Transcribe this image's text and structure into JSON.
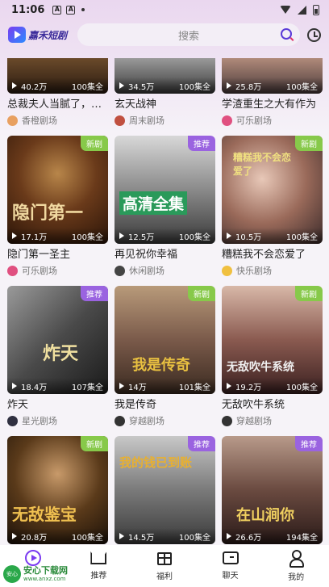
{
  "status_bar": {
    "time": "11:06",
    "icons": [
      "a-notification-icon",
      "a-notification-icon",
      "dot-icon",
      "wifi-icon",
      "signal-icon",
      "battery-icon"
    ]
  },
  "header": {
    "logo_text": "嘉禾短剧",
    "search_placeholder": "搜索"
  },
  "rows": [
    [
      {
        "views": "40.2万",
        "episodes": "100集全",
        "title": "总裁夫人当腻了，今...",
        "source": "香橙剧场",
        "badge": "",
        "poster_text": "",
        "bg": "#3a2a1a",
        "avatar": "#e8a060"
      },
      {
        "views": "34.5万",
        "episodes": "100集全",
        "title": "玄天战神",
        "source": "周末剧场",
        "badge": "",
        "poster_text": "",
        "bg": "#4a4a4a",
        "avatar": "#c05040"
      },
      {
        "views": "25.8万",
        "episodes": "100集全",
        "title": "学渣重生之大有作为",
        "source": "可乐剧场",
        "badge": "",
        "poster_text": "",
        "bg": "#6a5a5a",
        "avatar": "#e05080"
      }
    ],
    [
      {
        "views": "17.1万",
        "episodes": "100集全",
        "title": "隐门第一圣主",
        "source": "可乐剧场",
        "badge": "新剧",
        "badge_type": "new",
        "poster_text": "隐门第一",
        "bg": "#5a2a1a",
        "avatar": "#e05080"
      },
      {
        "views": "12.5万",
        "episodes": "100集全",
        "title": "再见祝你幸福",
        "source": "休闲剧场",
        "badge": "推荐",
        "badge_type": "rec",
        "poster_text": "高清全集",
        "bg": "#8a8a8a",
        "avatar": "#444444"
      },
      {
        "views": "10.5万",
        "episodes": "100集全",
        "title": "糟糕我不会恋爱了",
        "source": "快乐剧场",
        "badge": "新剧",
        "badge_type": "new",
        "poster_text": "糟糕我不会恋爱了",
        "bg": "#7a5a50",
        "avatar": "#f0c040"
      }
    ],
    [
      {
        "views": "18.4万",
        "episodes": "107集全",
        "title": "炸天",
        "source": "星光剧场",
        "badge": "推荐",
        "badge_type": "rec",
        "poster_text": "炸天",
        "bg": "#3a3a3a",
        "avatar": "#303040"
      },
      {
        "views": "14万",
        "episodes": "101集全",
        "title": "我是传奇",
        "source": "穿越剧场",
        "badge": "新剧",
        "badge_type": "new",
        "poster_text": "我是传奇",
        "bg": "#6a4a3a",
        "avatar": "#333333"
      },
      {
        "views": "19.2万",
        "episodes": "100集全",
        "title": "无敌吹牛系统",
        "source": "穿越剧场",
        "badge": "新剧",
        "badge_type": "new",
        "poster_text": "无敌吹牛系统",
        "bg": "#5a3a3a",
        "avatar": "#333333"
      }
    ],
    [
      {
        "views": "20.8万",
        "episodes": "100集全",
        "title": "",
        "source": "",
        "badge": "新剧",
        "badge_type": "new",
        "poster_text": "无敌鉴宝",
        "bg": "#3a2a1a",
        "avatar": ""
      },
      {
        "views": "14.5万",
        "episodes": "100集全",
        "title": "",
        "source": "",
        "badge": "推荐",
        "badge_type": "rec",
        "poster_text": "我的钱已到账",
        "bg": "#6a6a6a",
        "avatar": ""
      },
      {
        "views": "26.6万",
        "episodes": "194集全",
        "title": "",
        "source": "",
        "badge": "推荐",
        "badge_type": "rec",
        "poster_text": "在山涧你",
        "bg": "#5a4a4a",
        "avatar": ""
      }
    ]
  ],
  "bottom_nav": [
    {
      "label": "",
      "icon": "play-icon"
    },
    {
      "label": "推荐",
      "icon": "crown-icon"
    },
    {
      "label": "福利",
      "icon": "gift-icon"
    },
    {
      "label": "聊天",
      "icon": "chat-icon"
    },
    {
      "label": "我的",
      "icon": "user-icon"
    }
  ],
  "watermark": {
    "title": "安心下载网",
    "url": "www.anxz.com",
    "logo_text": "安心"
  }
}
